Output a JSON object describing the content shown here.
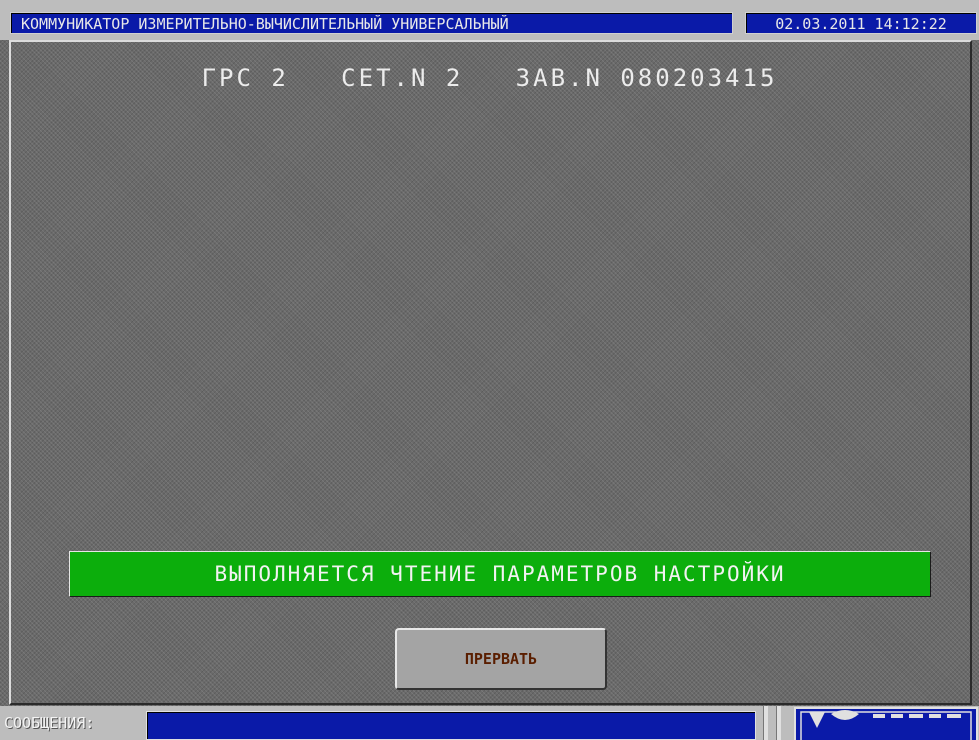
{
  "window": {
    "title": "КОММУНИКАТОР ИЗМЕРИТЕЛЬНО-ВЫЧИСЛИТЕЛЬНЫЙ УНИВЕРСАЛЬНЫЙ",
    "datetime": "02.03.2011 14:12:22"
  },
  "header": {
    "text": "ГРС 2   СЕТ.N 2   ЗАВ.N 080203415"
  },
  "status": {
    "message": "ВЫПОЛНЯЕТСЯ ЧТЕНИЕ ПАРАМЕТРОВ НАСТРОЙКИ",
    "color": "#0cae0c"
  },
  "actions": {
    "abort_label": "ПРЕРВАТЬ"
  },
  "footer": {
    "messages_label": "СООБЩЕНИЯ:",
    "messages_value": "",
    "logo_icon": "company-logo-icon"
  },
  "colors": {
    "title_bg": "#0a1aa8",
    "panel_bg": "#6a6a6a",
    "frame": "#bdbdbd"
  }
}
